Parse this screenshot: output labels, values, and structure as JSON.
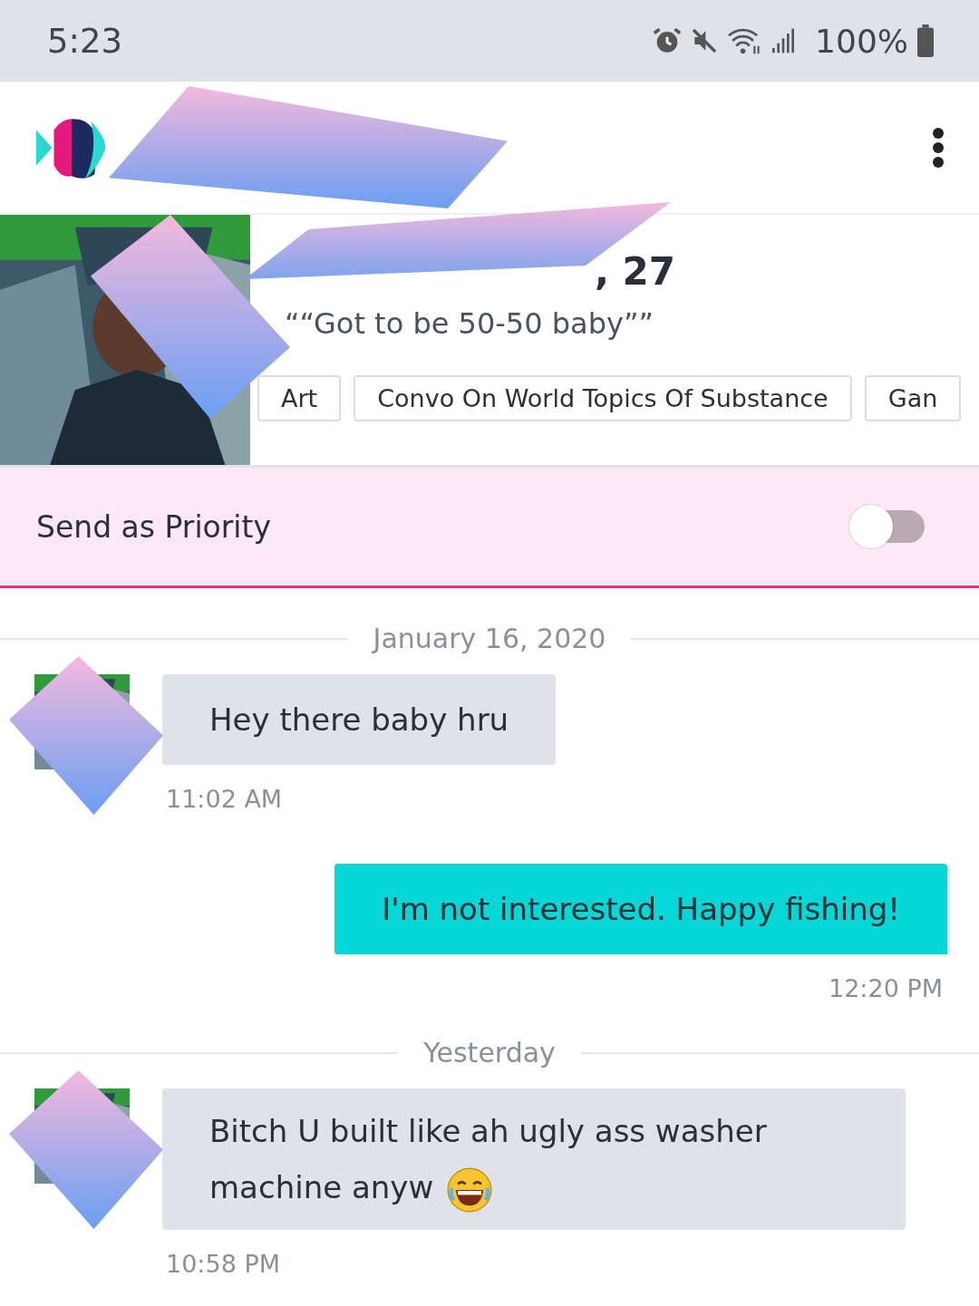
{
  "status_bar": {
    "time": "5:23",
    "battery": "100%"
  },
  "profile": {
    "name": ", 27",
    "quote": "““Got to be 50-50 baby””",
    "tags": [
      "Art",
      "Convo On World Topics Of Substance",
      "Gan"
    ]
  },
  "priority": {
    "label": "Send as Priority",
    "on": false
  },
  "messages": [
    {
      "kind": "date",
      "text": "January 16, 2020"
    },
    {
      "kind": "incoming",
      "text": "Hey there baby hru",
      "time": "11:02 AM"
    },
    {
      "kind": "outgoing",
      "text": "I'm not interested. Happy fishing!",
      "time": "12:20 PM"
    },
    {
      "kind": "date",
      "text": "Yesterday"
    },
    {
      "kind": "incoming",
      "text": "Bitch U built like ah ugly ass washer machine anyw",
      "emoji": true,
      "time": "10:58 PM"
    }
  ]
}
